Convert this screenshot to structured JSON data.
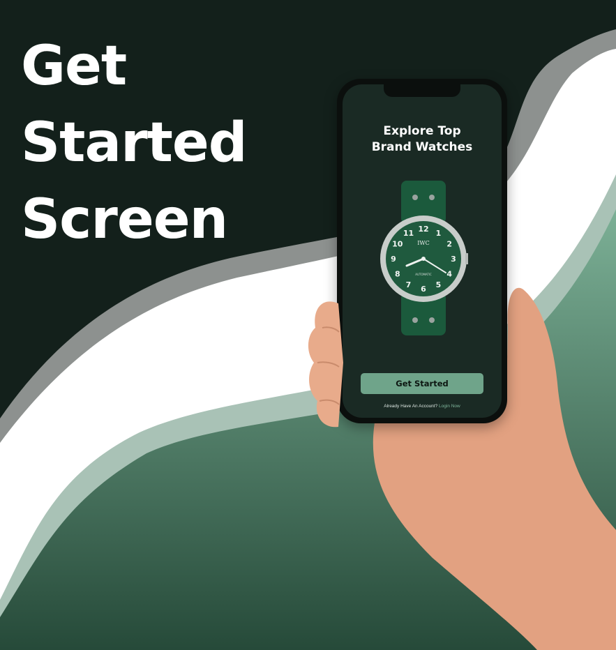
{
  "headline": [
    "Get",
    "Started",
    "Screen"
  ],
  "app": {
    "title_line1": "Explore Top",
    "title_line2": "Brand Watches",
    "cta_label": "Get Started",
    "footer_question": "Already Have An Account?",
    "footer_link": "Login Now"
  },
  "watch": {
    "brand": "IWC",
    "caption": "AUTOMATIC",
    "dial_numbers": [
      "12",
      "1",
      "2",
      "3",
      "4",
      "5",
      "6",
      "7",
      "8",
      "9",
      "10",
      "11"
    ]
  },
  "colors": {
    "background_dark": "#13201b",
    "wave_gray": "#8d918f",
    "wave_white": "#ffffff",
    "green_accent": "#6fa48a",
    "dial_green": "#1f5a3e",
    "phone_screen": "#1a2a24"
  }
}
